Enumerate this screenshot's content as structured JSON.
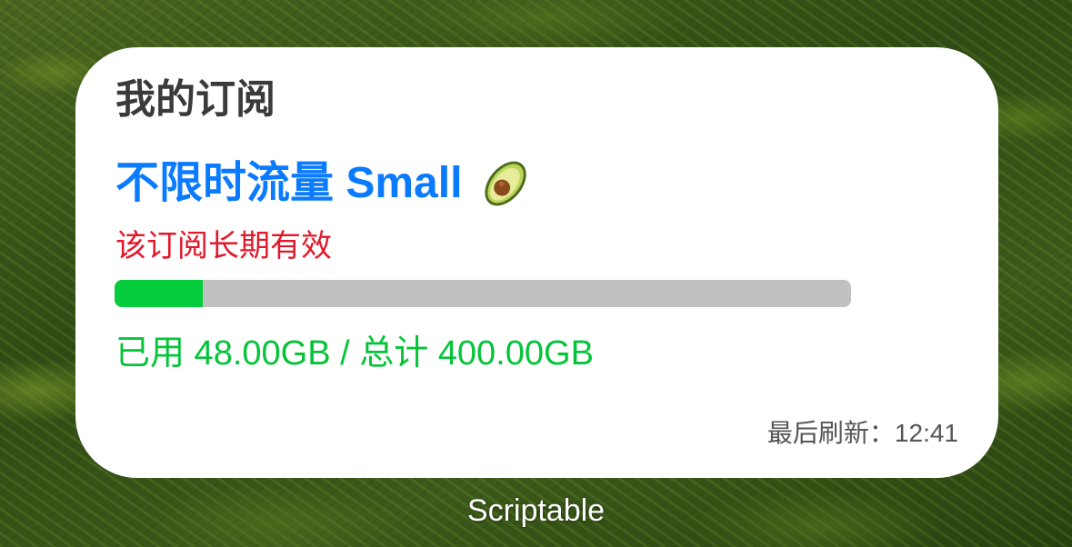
{
  "widget": {
    "title": "我的订阅",
    "plan_name": "不限时流量 Small",
    "plan_icon": "avocado-icon",
    "validity": "该订阅长期有效",
    "usage": {
      "text": "已用 48.00GB / 总计 400.00GB",
      "used_gb": 48.0,
      "total_gb": 400.0,
      "fraction": 0.12
    },
    "last_refresh": "最后刷新：12:41"
  },
  "app_label": "Scriptable",
  "colors": {
    "plan_name": "#0a7bff",
    "validity": "#e0192b",
    "progress_fill": "#05cc3a",
    "progress_track": "#c0c0c0",
    "usage_text": "#05c43a"
  }
}
